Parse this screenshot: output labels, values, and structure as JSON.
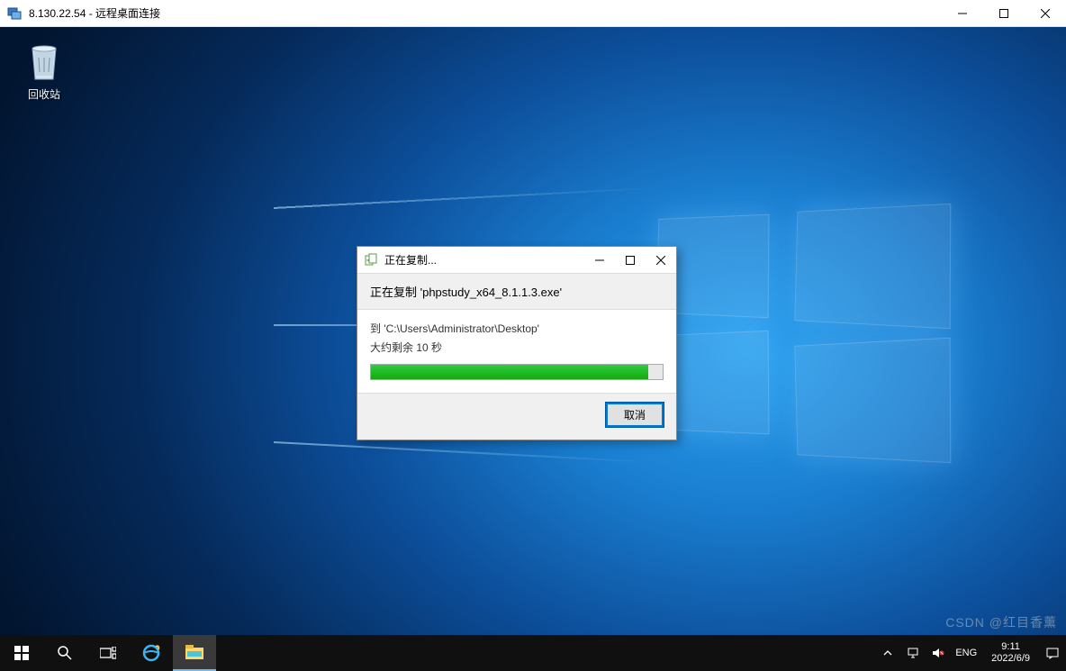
{
  "outer_window": {
    "title": "8.130.22.54 - 远程桌面连接"
  },
  "desktop": {
    "recycle_bin_label": "回收站"
  },
  "copy_dialog": {
    "title": "正在复制...",
    "header": "正在复制 'phpstudy_x64_8.1.1.3.exe'",
    "destination": "到 'C:\\Users\\Administrator\\Desktop'",
    "eta": "大约剩余 10 秒",
    "progress_percent": 95,
    "cancel_label": "取消"
  },
  "taskbar": {
    "tray": {
      "ime": "ENG",
      "time": "9:11",
      "date": "2022/6/9"
    }
  },
  "watermark": "CSDN @红目香薰",
  "colors": {
    "progress_green": "#16a810",
    "accent_blue": "#0078d7",
    "taskbar_bg": "#101010"
  }
}
